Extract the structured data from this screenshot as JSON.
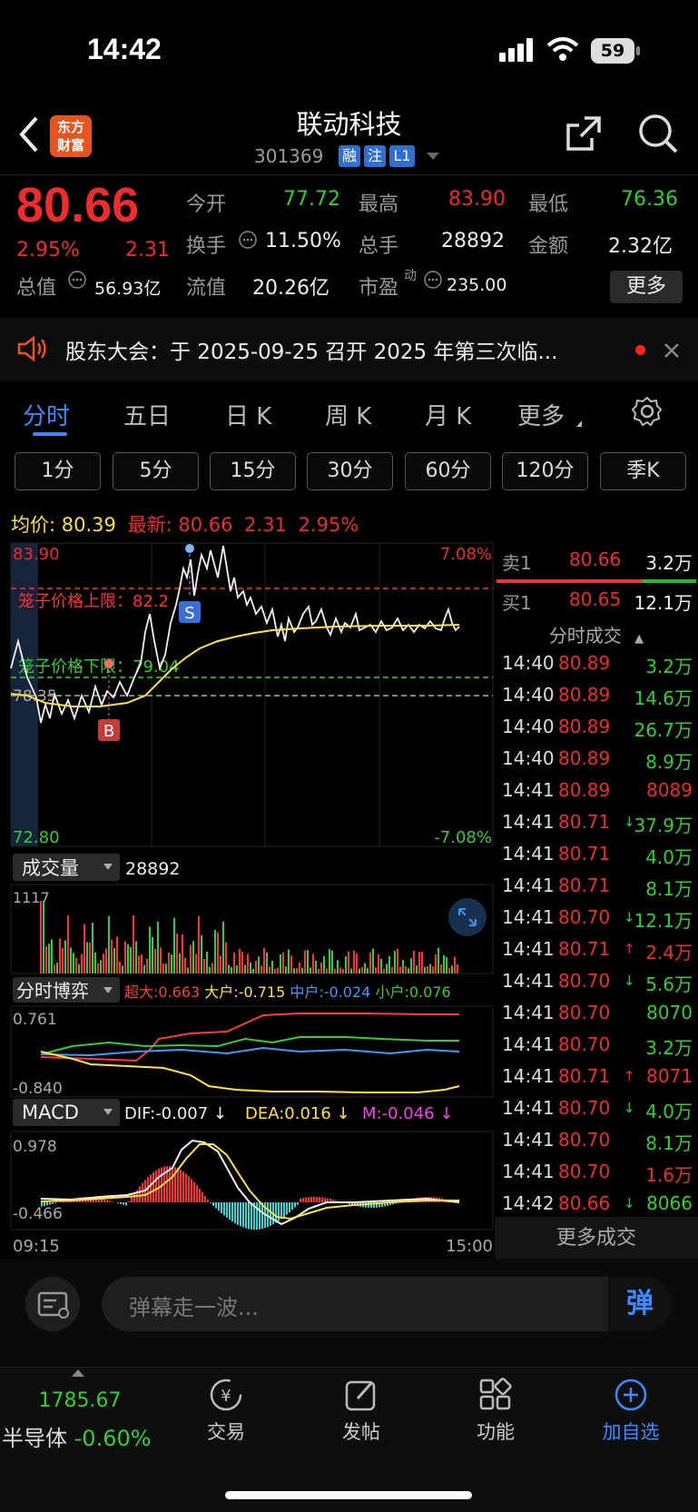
{
  "status": {
    "time": "14:42",
    "battery": "59"
  },
  "header": {
    "title": "联动科技",
    "code": "301369",
    "badges": [
      "融",
      "注",
      "L1"
    ],
    "logo_line1": "东方",
    "logo_line2": "财富"
  },
  "quote": {
    "price": "80.66",
    "pct": "2.95%",
    "change": "2.31",
    "open_label": "今开",
    "open": "77.72",
    "high_label": "最高",
    "high": "83.90",
    "low_label": "最低",
    "low": "76.36",
    "turnover_label": "换手",
    "turnover": "11.50%",
    "vol_label": "总手",
    "vol": "28892",
    "amount_label": "金额",
    "amount": "2.32亿",
    "mktcap_label": "总值",
    "mktcap": "56.93亿",
    "float_label": "流值",
    "float": "20.26亿",
    "pe_label": "市盈",
    "pe_sup": "动",
    "pe": "235.00",
    "more": "更多"
  },
  "notice": {
    "text": "股东大会：于 2025-09-25 召开 2025 年第三次临..."
  },
  "tabs": [
    "分时",
    "五日",
    "日 K",
    "周 K",
    "月 K",
    "更多"
  ],
  "periods": [
    "1分",
    "5分",
    "15分",
    "30分",
    "60分",
    "120分",
    "季K"
  ],
  "chart": {
    "avg_label": "均价:",
    "avg": "80.39",
    "last_label": "最新:",
    "last": "80.66",
    "last_change": "2.31",
    "last_pct": "2.95%",
    "max_price": "83.90",
    "min_price": "72.80",
    "max_pct": "7.08%",
    "min_pct": "-7.08%",
    "prev_close": "78.35",
    "upper_limit_label": "笼子价格上限：82.2",
    "lower_limit_label": "笼子价格下限：79.04",
    "buy_marker": "B",
    "sell_marker": "S",
    "vol_label": "成交量",
    "vol_value": "28892",
    "vol_max": "1117",
    "game_label": "分时博弈",
    "game_legend": [
      {
        "label": "超大:0.663",
        "color": "#ff3b3b"
      },
      {
        "label": "大户:-0.715",
        "color": "#ffe23b"
      },
      {
        "label": "中户:-0.024",
        "color": "#3b9bff"
      },
      {
        "label": "小户:0.076",
        "color": "#2fd12f"
      }
    ],
    "game_max": "0.761",
    "game_min": "-0.840",
    "macd_label": "MACD",
    "dif": "DIF:-0.007 ↓",
    "dea": "DEA:0.016 ↓",
    "m": "M:-0.046 ↓",
    "macd_max": "0.978",
    "macd_min": "-0.466",
    "time_start": "09:15",
    "time_end": "15:00"
  },
  "orderbook": {
    "sell": {
      "label": "卖1",
      "price": "80.66",
      "vol": "3.2万"
    },
    "buy": {
      "label": "买1",
      "price": "80.65",
      "vol": "12.1万"
    },
    "trades_label": "分时成交",
    "trades": [
      {
        "t": "14:40",
        "p": "80.89",
        "v": "3.2万",
        "c": "red",
        "a": "",
        "vc": "green"
      },
      {
        "t": "14:40",
        "p": "80.89",
        "v": "14.6万",
        "c": "red",
        "a": "",
        "vc": "green"
      },
      {
        "t": "14:40",
        "p": "80.89",
        "v": "26.7万",
        "c": "red",
        "a": "",
        "vc": "green"
      },
      {
        "t": "14:40",
        "p": "80.89",
        "v": "8.9万",
        "c": "red",
        "a": "",
        "vc": "green"
      },
      {
        "t": "14:41",
        "p": "80.89",
        "v": "8089",
        "c": "red",
        "a": "",
        "vc": "red"
      },
      {
        "t": "14:41",
        "p": "80.71",
        "v": "37.9万",
        "c": "red",
        "a": "↓",
        "vc": "green"
      },
      {
        "t": "14:41",
        "p": "80.71",
        "v": "4.0万",
        "c": "red",
        "a": "",
        "vc": "green"
      },
      {
        "t": "14:41",
        "p": "80.71",
        "v": "8.1万",
        "c": "red",
        "a": "",
        "vc": "green"
      },
      {
        "t": "14:41",
        "p": "80.70",
        "v": "12.1万",
        "c": "red",
        "a": "↓",
        "vc": "green"
      },
      {
        "t": "14:41",
        "p": "80.71",
        "v": "2.4万",
        "c": "red",
        "a": "↑",
        "vc": "red"
      },
      {
        "t": "14:41",
        "p": "80.70",
        "v": "5.6万",
        "c": "red",
        "a": "↓",
        "vc": "green"
      },
      {
        "t": "14:41",
        "p": "80.70",
        "v": "8070",
        "c": "red",
        "a": "",
        "vc": "green"
      },
      {
        "t": "14:41",
        "p": "80.70",
        "v": "3.2万",
        "c": "red",
        "a": "",
        "vc": "green"
      },
      {
        "t": "14:41",
        "p": "80.71",
        "v": "8071",
        "c": "red",
        "a": "↑",
        "vc": "red"
      },
      {
        "t": "14:41",
        "p": "80.70",
        "v": "4.0万",
        "c": "red",
        "a": "↓",
        "vc": "green"
      },
      {
        "t": "14:41",
        "p": "80.70",
        "v": "8.1万",
        "c": "red",
        "a": "",
        "vc": "green"
      },
      {
        "t": "14:41",
        "p": "80.70",
        "v": "1.6万",
        "c": "red",
        "a": "",
        "vc": "red"
      },
      {
        "t": "14:42",
        "p": "80.66",
        "v": "8066",
        "c": "red",
        "a": "↓",
        "vc": "green"
      }
    ],
    "more_trades": "更多成交"
  },
  "danmaku": {
    "placeholder": "弹幕走一波...",
    "button": "弹"
  },
  "bottom": {
    "index_value": "1785.67",
    "index_name": "半导体",
    "index_pct": "-0.60%",
    "trade": "交易",
    "post": "发帖",
    "func": "功能",
    "watch": "加自选"
  }
}
